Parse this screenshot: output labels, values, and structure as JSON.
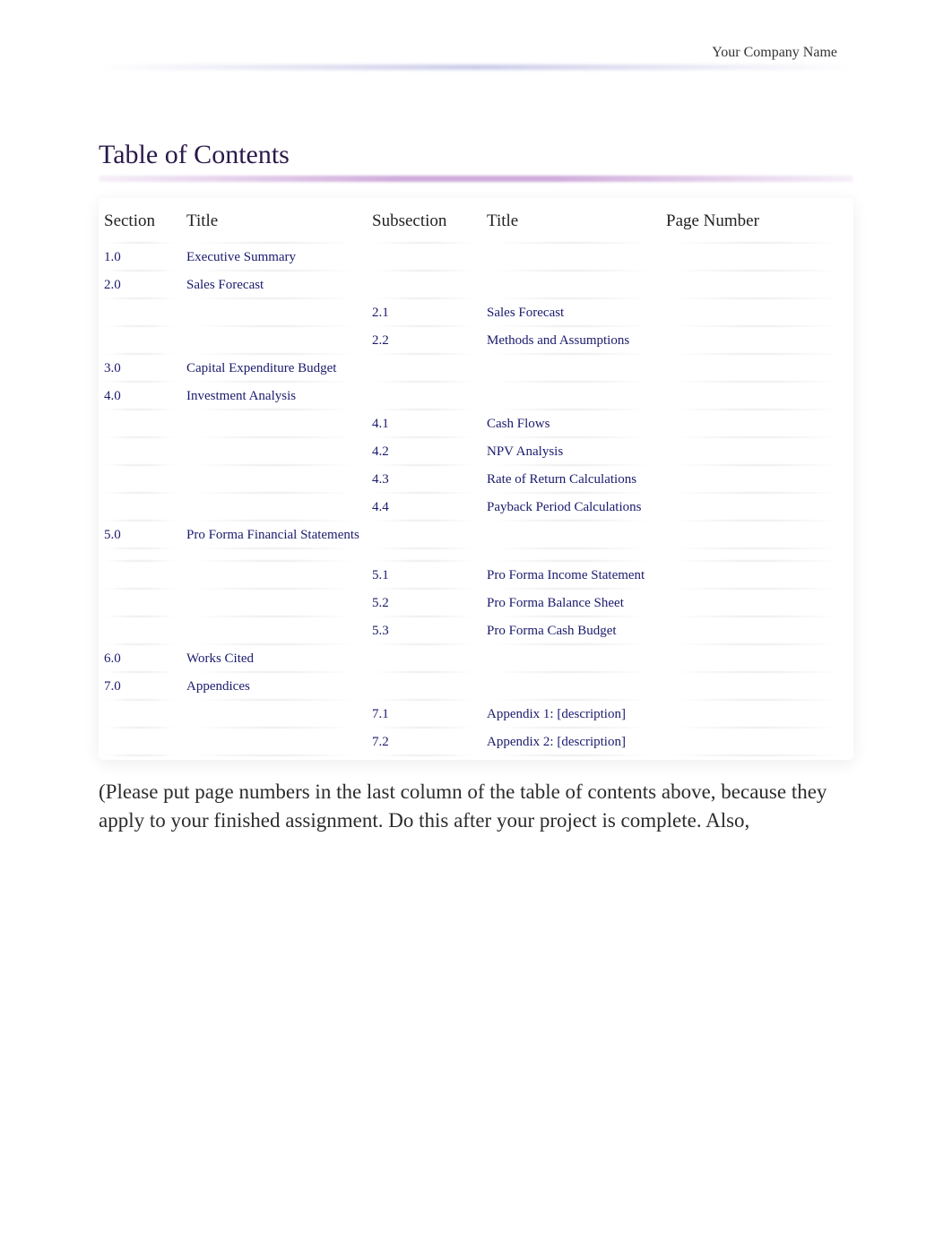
{
  "header": {
    "company_name": "Your Company Name"
  },
  "toc": {
    "heading": "Table of Contents",
    "columns": {
      "section": "Section",
      "title": "Title",
      "subsection": "Subsection",
      "subtitle": "Title",
      "page": "Page Number"
    },
    "rows": [
      {
        "section": "1.0",
        "title": "Executive Summary",
        "subsection": "",
        "subtitle": "",
        "page": ""
      },
      {
        "section": "2.0",
        "title": "Sales Forecast",
        "subsection": "",
        "subtitle": "",
        "page": ""
      },
      {
        "section": "",
        "title": "",
        "subsection": "2.1",
        "subtitle": "Sales Forecast",
        "page": ""
      },
      {
        "section": "",
        "title": "",
        "subsection": "2.2",
        "subtitle": "Methods and Assumptions",
        "page": ""
      },
      {
        "section": "3.0",
        "title": "Capital Expenditure Budget",
        "subsection": "",
        "subtitle": "",
        "page": ""
      },
      {
        "section": "4.0",
        "title": "Investment Analysis",
        "subsection": "",
        "subtitle": "",
        "page": ""
      },
      {
        "section": "",
        "title": "",
        "subsection": "4.1",
        "subtitle": "Cash Flows",
        "page": ""
      },
      {
        "section": "",
        "title": "",
        "subsection": "4.2",
        "subtitle": "NPV Analysis",
        "page": ""
      },
      {
        "section": "",
        "title": "",
        "subsection": "4.3",
        "subtitle": "Rate of Return Calculations",
        "page": ""
      },
      {
        "section": "",
        "title": "",
        "subsection": "4.4",
        "subtitle": "Payback Period Calculations",
        "page": ""
      },
      {
        "section": "5.0",
        "title": "Pro Forma Financial Statements",
        "subsection": "",
        "subtitle": "",
        "page": ""
      },
      {
        "section": "",
        "title": "",
        "subsection": "",
        "subtitle": "",
        "page": ""
      },
      {
        "section": "",
        "title": "",
        "subsection": "5.1",
        "subtitle": "Pro Forma Income Statement",
        "page": ""
      },
      {
        "section": "",
        "title": "",
        "subsection": "5.2",
        "subtitle": "Pro Forma Balance Sheet",
        "page": ""
      },
      {
        "section": "",
        "title": "",
        "subsection": "5.3",
        "subtitle": "Pro Forma Cash Budget",
        "page": ""
      },
      {
        "section": "6.0",
        "title": "Works Cited",
        "subsection": "",
        "subtitle": "",
        "page": ""
      },
      {
        "section": "7.0",
        "title": "Appendices",
        "subsection": "",
        "subtitle": "",
        "page": ""
      },
      {
        "section": "",
        "title": "",
        "subsection": "7.1",
        "subtitle": "Appendix 1: [description]",
        "page": ""
      },
      {
        "section": "",
        "title": "",
        "subsection": "7.2",
        "subtitle": "Appendix 2: [description]",
        "page": ""
      }
    ]
  },
  "instruction_text": "(Please put page numbers in the last column of the table of contents above, because they apply to your finished assignment. Do this after your project is complete. Also,"
}
